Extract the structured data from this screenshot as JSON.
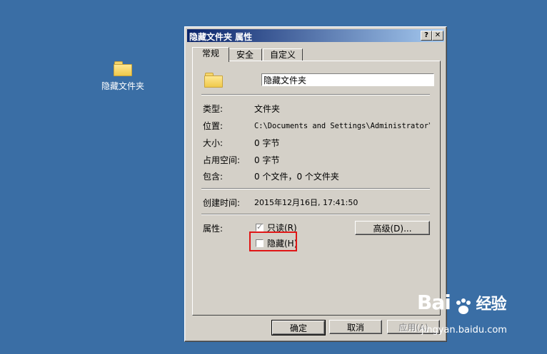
{
  "desktop": {
    "folder_label": "隐藏文件夹"
  },
  "dialog": {
    "title": "隐藏文件夹 属性",
    "help_btn": "?",
    "close_btn": "✕",
    "tabs": [
      {
        "label": "常规"
      },
      {
        "label": "安全"
      },
      {
        "label": "自定义"
      }
    ],
    "name_value": "隐藏文件夹",
    "rows": [
      {
        "label": "类型:",
        "value": "文件夹"
      },
      {
        "label": "位置:",
        "value": "C:\\Documents and Settings\\Administrator\\桌"
      },
      {
        "label": "大小:",
        "value": "0 字节"
      },
      {
        "label": "占用空间:",
        "value": "0 字节"
      },
      {
        "label": "包含:",
        "value": "0 个文件，0 个文件夹"
      }
    ],
    "created": {
      "label": "创建时间:",
      "value": "2015年12月16日, 17:41:50"
    },
    "attributes": {
      "label": "属性:",
      "readonly_label": "只读(R)",
      "hidden_label": "隐藏(H)",
      "advanced_btn": "高级(D)..."
    },
    "buttons": {
      "ok": "确定",
      "cancel": "取消",
      "apply": "应用(A)"
    }
  },
  "watermark": {
    "logo_left": "Bai",
    "logo_right": "经验",
    "url": "jingyan.baidu.com"
  }
}
